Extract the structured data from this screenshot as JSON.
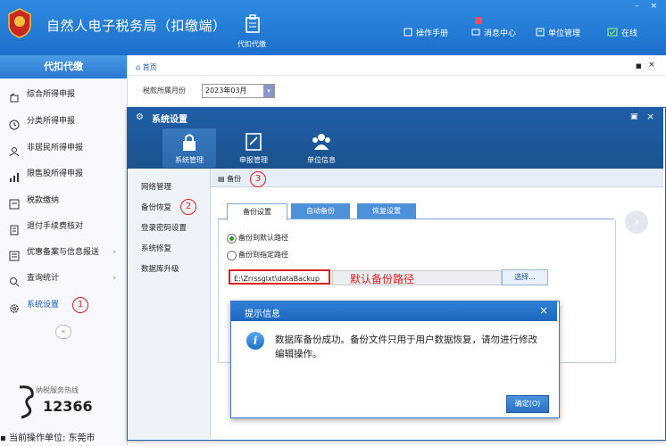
{
  "app": {
    "title": "自然人电子税务局（扣缴端）",
    "module": "代扣代缴"
  },
  "toolbar": {
    "manual": "操作手册",
    "messages": "消息中心",
    "unit_mgmt": "单位管理",
    "online": "在线"
  },
  "sidebar": {
    "title": "代扣代缴",
    "items": [
      {
        "label": "综合所得申报",
        "icon": "wallet-icon"
      },
      {
        "label": "分类所得申报",
        "icon": "clock-icon"
      },
      {
        "label": "非居民所得申报",
        "icon": "person-icon"
      },
      {
        "label": "限售股所得申报",
        "icon": "bar-chart-icon"
      },
      {
        "label": "税款缴纳",
        "icon": "document-icon"
      },
      {
        "label": "退付手续费核对",
        "icon": "receipt-icon"
      },
      {
        "label": "优惠备案与信息报送",
        "icon": "list-icon",
        "arrow": "›"
      },
      {
        "label": "查询统计",
        "icon": "search-icon",
        "arrow": "›"
      },
      {
        "label": "系统设置",
        "icon": "gear-icon",
        "selected": true
      }
    ],
    "collapse": "«",
    "hotline_label": "纳税服务热线",
    "hotline_number": "12366",
    "status_text": "当前操作单位: 东莞市"
  },
  "main": {
    "home_tab": "首页",
    "month_label": "税款所属月份",
    "month_value": "2023年03月"
  },
  "dialog": {
    "title": "系统设置",
    "tabs": [
      {
        "label": "系统管理",
        "active": true
      },
      {
        "label": "申报管理"
      },
      {
        "label": "单位信息"
      }
    ],
    "left_nav": [
      "网络管理",
      "备份恢复",
      "登录密码设置",
      "系统修复",
      "数据库升级"
    ],
    "crumb": "备份",
    "inner_tabs": [
      "备份设置",
      "自动备份",
      "恢复设置"
    ],
    "radio_default": "备份到默认路径",
    "radio_custom": "备份到指定路径",
    "path_value": "E:\\Zrrssglxt\\dataBackup",
    "choose_btn": "选择..."
  },
  "annotations": {
    "step1": "1",
    "step2": "2",
    "step3": "3",
    "note": "默认备份路径"
  },
  "popup": {
    "title": "提示信息",
    "close": "×",
    "icon": "i",
    "message": "数据库备份成功。备份文件只用于用户数据恢复，请勿进行修改编辑操作。",
    "ok": "确定(O)"
  },
  "colors": {
    "brand": "#1c6fcb",
    "annotation": "#e02020",
    "dialog_header": "#1f5fa6"
  }
}
